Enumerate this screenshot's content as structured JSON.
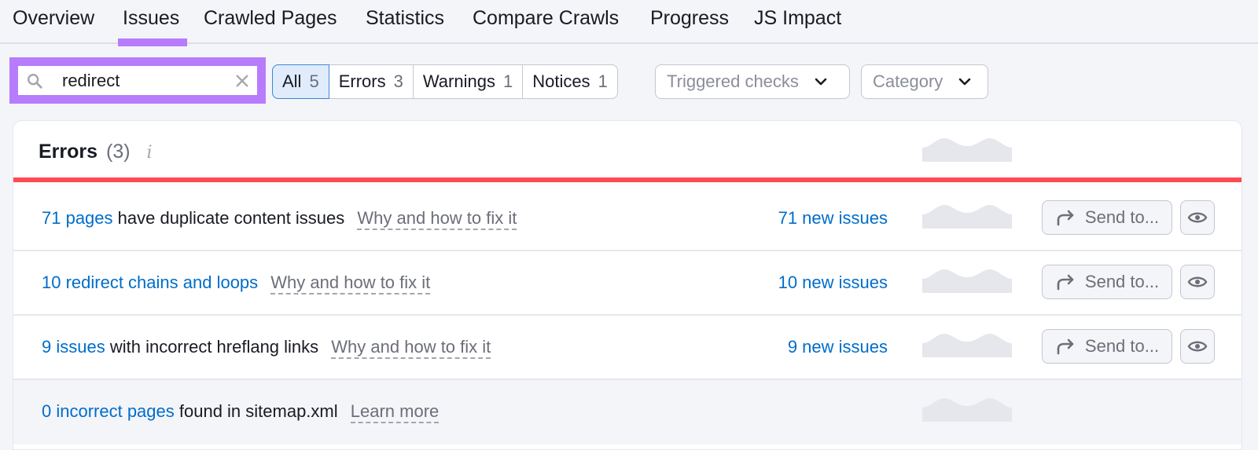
{
  "tabs": [
    {
      "label": "Overview",
      "active": false
    },
    {
      "label": "Issues",
      "active": true
    },
    {
      "label": "Crawled Pages",
      "active": false
    },
    {
      "label": "Statistics",
      "active": false
    },
    {
      "label": "Compare Crawls",
      "active": false
    },
    {
      "label": "Progress",
      "active": false
    },
    {
      "label": "JS Impact",
      "active": false
    }
  ],
  "search": {
    "value": "redirect",
    "icon": "search-icon",
    "clear_icon": "close-icon"
  },
  "filters": [
    {
      "label": "All",
      "count": "5",
      "active": true
    },
    {
      "label": "Errors",
      "count": "3",
      "active": false
    },
    {
      "label": "Warnings",
      "count": "1",
      "active": false
    },
    {
      "label": "Notices",
      "count": "1",
      "active": false
    }
  ],
  "dropdowns": {
    "triggered_checks": "Triggered checks",
    "category": "Category"
  },
  "section": {
    "title": "Errors",
    "count": "(3)",
    "info_glyph": "i",
    "accent_color": "#ff4953"
  },
  "rows": [
    {
      "link_text": "71 pages",
      "text": " have duplicate content issues",
      "help": "Why and how to fix it",
      "new_issues": "71 new issues",
      "send_label": "Send to...",
      "has_actions": true
    },
    {
      "link_text": "10 redirect chains and loops",
      "text": "",
      "help": "Why and how to fix it",
      "new_issues": "10 new issues",
      "send_label": "Send to...",
      "has_actions": true
    },
    {
      "link_text": "9 issues",
      "text": " with incorrect hreflang links",
      "help": "Why and how to fix it",
      "new_issues": "9 new issues",
      "send_label": "Send to...",
      "has_actions": true
    },
    {
      "link_text": "0 incorrect pages",
      "text": " found in sitemap.xml",
      "help": "Learn more",
      "new_issues": "",
      "send_label": "",
      "has_actions": false
    }
  ],
  "colors": {
    "accent_purple": "#b77cfb",
    "link_blue": "#006dca",
    "error_red": "#ff4953",
    "active_filter_bg": "#e0ecfc"
  }
}
